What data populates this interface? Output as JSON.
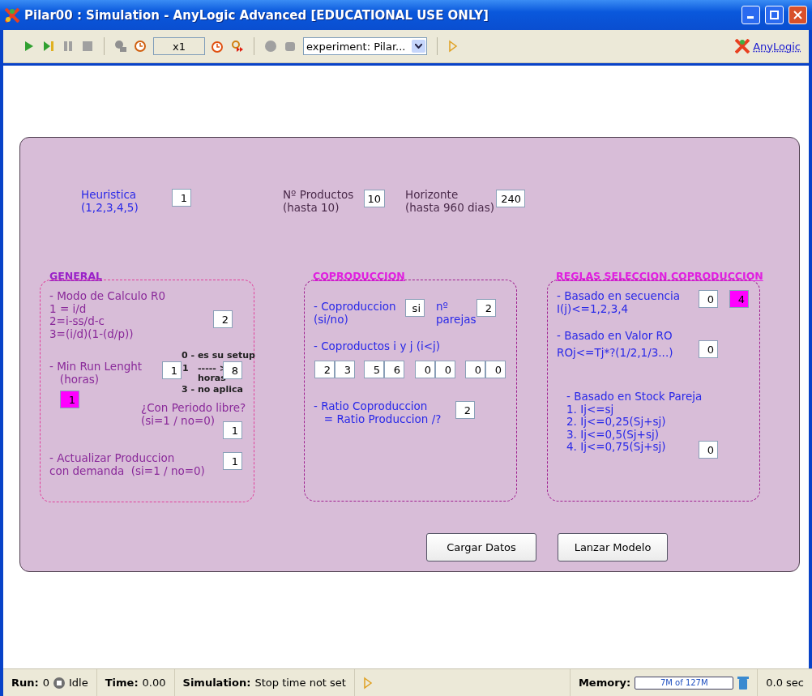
{
  "window": {
    "title": "Pilar00 : Simulation - AnyLogic Advanced [EDUCATIONAL USE ONLY]"
  },
  "toolbar": {
    "speed": "x1",
    "experiment": "experiment: Pilar...",
    "brand_link": "AnyLogic"
  },
  "canvas": {
    "sections": [
      {
        "heading": "GENERAL",
        "color": "#9a22c8"
      },
      {
        "heading": "COPRODUCCION",
        "color": "#e020e0"
      },
      {
        "heading": "REGLAS SELECCION COPRODUCCION",
        "color": "#e020e0"
      }
    ],
    "texts": [
      {
        "text": "Heuristica\n(1,2,3,4,5)",
        "color": "#2828e8"
      },
      {
        "text": "Nº Productos\n(hasta 10)",
        "color": "#4a2a4a"
      },
      {
        "text": "Horizonte\n(hasta 960 dias)",
        "color": "#4a2a4a"
      },
      {
        "text": "- Modo de Calculo R0\n1 = i/d\n2=i-ss/d-c\n3=(i/d)(1-(d/p))",
        "color": "#8a2a9a"
      },
      {
        "text": "0 - es su setup",
        "color": "#202020"
      },
      {
        "text": "1",
        "color": "#202020"
      },
      {
        "text": "----- >",
        "color": "#202020"
      },
      {
        "text": "horas",
        "color": "#202020"
      },
      {
        "text": "3 - no aplica",
        "color": "#202020"
      },
      {
        "text": "- Min Run Lenght\n   (horas)",
        "color": "#8a2a9a"
      },
      {
        "text": "¿Con Periodo libre?\n(si=1 / no=0)",
        "color": "#8a2a9a"
      },
      {
        "text": "- Actualizar Produccion\ncon demanda  (si=1 / no=0)",
        "color": "#8a2a9a"
      },
      {
        "text": "- Coproduccion\n(si/no)",
        "color": "#2828e8"
      },
      {
        "text": "nº\nparejas",
        "color": "#2828e8"
      },
      {
        "text": "- Coproductos i y j (i<j)",
        "color": "#2828e8"
      },
      {
        "text": "- Ratio Coproduccion\n   = Ratio Produccion /?",
        "color": "#2828e8"
      },
      {
        "text": "- Basado en secuencia\nI(j)<=1,2,3,4",
        "color": "#2828e8"
      },
      {
        "text": "- Basado en Valor RO",
        "color": "#2828e8"
      },
      {
        "text": "ROj<=Tj*?(1/2,1/3...)",
        "color": "#2828e8"
      },
      {
        "text": "- Basado en Stock Pareja\n1. Ij<=sj\n2. Ij<=0,25(Sj+sj)\n3. Ij<=0,5(Sj+sj)\n4. Ij<=0,75(Sj+sj)",
        "color": "#2828e8"
      }
    ],
    "fields": [
      {
        "value": "1",
        "color": "#ffffff"
      },
      {
        "value": "10",
        "color": "#ffffff"
      },
      {
        "value": "240",
        "color": "#ffffff"
      },
      {
        "value": "2",
        "color": "#ffffff"
      },
      {
        "value": "1",
        "color": "#ffffff"
      },
      {
        "value": "8",
        "color": "#ffffff"
      },
      {
        "value": "1",
        "color": "#ff00ff"
      },
      {
        "value": "1",
        "color": "#ffffff"
      },
      {
        "value": "1",
        "color": "#ffffff"
      },
      {
        "value": "si",
        "color": "#ffffff"
      },
      {
        "value": "2",
        "color": "#ffffff"
      },
      {
        "value": "2",
        "color": "#ffffff"
      },
      {
        "value": "3",
        "color": "#ffffff"
      },
      {
        "value": "5",
        "color": "#ffffff"
      },
      {
        "value": "6",
        "color": "#ffffff"
      },
      {
        "value": "0",
        "color": "#ffffff"
      },
      {
        "value": "0",
        "color": "#ffffff"
      },
      {
        "value": "0",
        "color": "#ffffff"
      },
      {
        "value": "0",
        "color": "#ffffff"
      },
      {
        "value": "2",
        "color": "#ffffff"
      },
      {
        "value": "0",
        "color": "#ffffff"
      },
      {
        "value": "4",
        "color": "#ff00ff"
      },
      {
        "value": "0",
        "color": "#ffffff"
      },
      {
        "value": "0",
        "color": "#ffffff"
      }
    ],
    "buttons": [
      "Cargar Datos",
      "Lanzar Modelo"
    ]
  },
  "status_bar": {
    "run_label": "Run:",
    "run_value": "0",
    "state": "Idle",
    "time_label": "Time:",
    "time_value": "0.00",
    "simulation_label": "Simulation:",
    "simulation_value": "Stop time not set",
    "memory_label": "Memory:",
    "memory_value": "7M of 127M",
    "elapsed": "0.0 sec"
  }
}
